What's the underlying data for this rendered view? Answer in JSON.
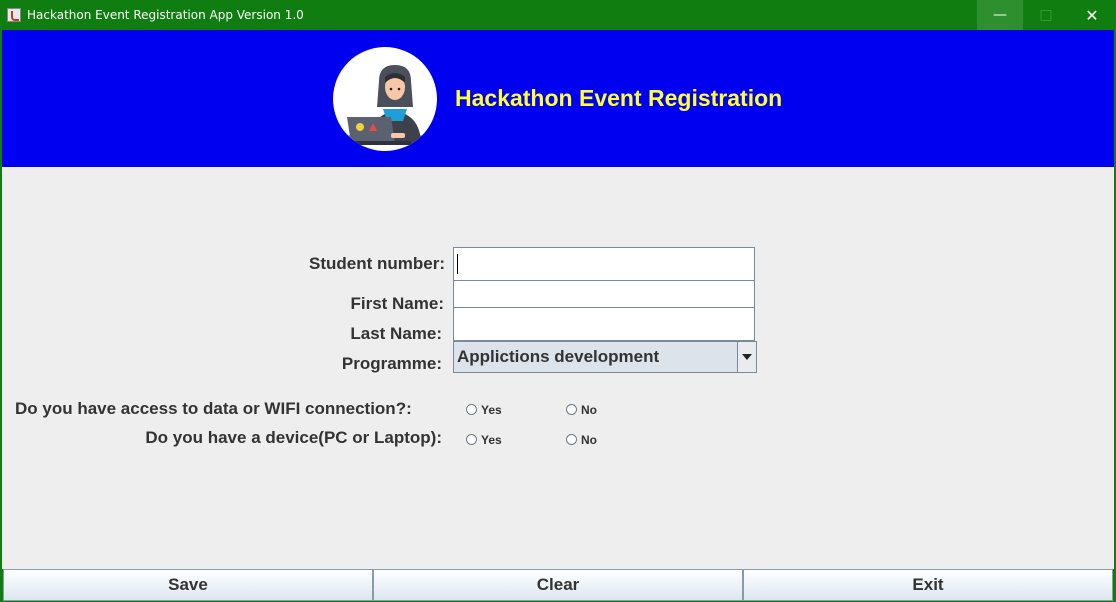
{
  "window": {
    "title": "Hackathon Event Registration App Version 1.0",
    "controls": {
      "minimize": "—",
      "maximize": "□",
      "close": "✕"
    }
  },
  "banner": {
    "title": "Hackathon Event Registration",
    "background_color": "#0000f0",
    "title_color": "#ffff33",
    "logo_icon": "hacker-avatar-icon"
  },
  "form": {
    "student_number": {
      "label": "Student number:",
      "value": ""
    },
    "first_name": {
      "label": "First Name:",
      "value": ""
    },
    "last_name": {
      "label": "Last Name:",
      "value": ""
    },
    "programme": {
      "label": "Programme:",
      "selected": "Applictions development"
    },
    "wifi_question": {
      "label": "Do you have access to data or WIFI connection?:",
      "yes": "Yes",
      "no": "No"
    },
    "device_question": {
      "label": "Do you have a device(PC or Laptop):",
      "yes": "Yes",
      "no": "No"
    }
  },
  "buttons": {
    "save": "Save",
    "clear": "Clear",
    "exit": "Exit"
  },
  "colors": {
    "titlebar": "#0f7d10",
    "content_bg": "#eeeeee"
  }
}
